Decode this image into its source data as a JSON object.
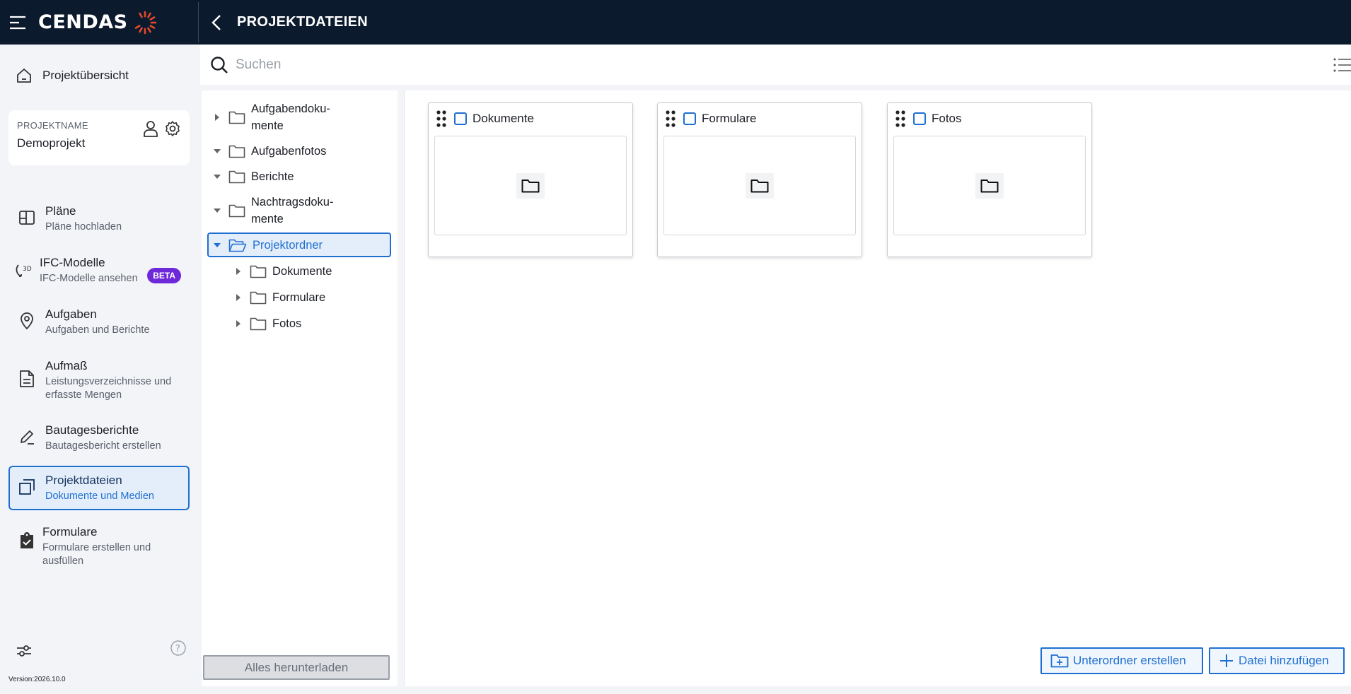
{
  "header": {
    "logo_text": "CENDAS",
    "page_title": "PROJEKTDATEIEN"
  },
  "sidebar": {
    "overview_label": "Projektübersicht",
    "project_caption": "PROJEKTNAME",
    "project_name": "Demoprojekt",
    "items": [
      {
        "title": "Pläne",
        "subtitle": "Pläne hochladen",
        "icon": "plans-icon"
      },
      {
        "title": "IFC-Modelle",
        "subtitle": "IFC-Modelle ansehen",
        "icon": "3d-icon",
        "badge": "BETA"
      },
      {
        "title": "Aufgaben",
        "subtitle": "Aufgaben und Berichte",
        "icon": "location-pin-icon"
      },
      {
        "title": "Aufmaß",
        "subtitle": "Leistungsverzeichnisse und erfasste Mengen",
        "icon": "document-icon"
      },
      {
        "title": "Bautagesberichte",
        "subtitle": "Bautagesbericht erstellen",
        "icon": "pen-icon"
      },
      {
        "title": "Projektdateien",
        "subtitle": "Dokumente und Medien",
        "icon": "files-icon",
        "active": true
      },
      {
        "title": "Formulare",
        "subtitle": "Formulare erstellen und ausfüllen",
        "icon": "clipboard-icon"
      }
    ],
    "version": "Version:2026.10.0"
  },
  "search": {
    "placeholder": "Suchen",
    "value": ""
  },
  "tree": {
    "items": [
      {
        "name": "Aufgabendoku-\nmente",
        "expanded": false,
        "level": 0
      },
      {
        "name": "Aufgabenfotos",
        "expanded": true,
        "level": 0
      },
      {
        "name": "Berichte",
        "expanded": true,
        "level": 0
      },
      {
        "name": "Nachtragsdoku-\nmente",
        "expanded": true,
        "level": 0
      },
      {
        "name": "Projektordner",
        "expanded": true,
        "level": 0,
        "selected": true
      },
      {
        "name": "Dokumente",
        "expanded": false,
        "level": 1
      },
      {
        "name": "Formulare",
        "expanded": false,
        "level": 1
      },
      {
        "name": "Fotos",
        "expanded": false,
        "level": 1
      }
    ],
    "download_label": "Alles herunterladen"
  },
  "folders": [
    {
      "name": "Dokumente"
    },
    {
      "name": "Formulare"
    },
    {
      "name": "Fotos"
    }
  ],
  "actions": {
    "create_subfolder": "Unterordner erstellen",
    "add_file": "Datei hinzufügen"
  },
  "colors": {
    "header_bg": "#0c1a2e",
    "accent": "#1f6fd1",
    "beta": "#6d28d9",
    "logo_mark": "#e5482b"
  }
}
